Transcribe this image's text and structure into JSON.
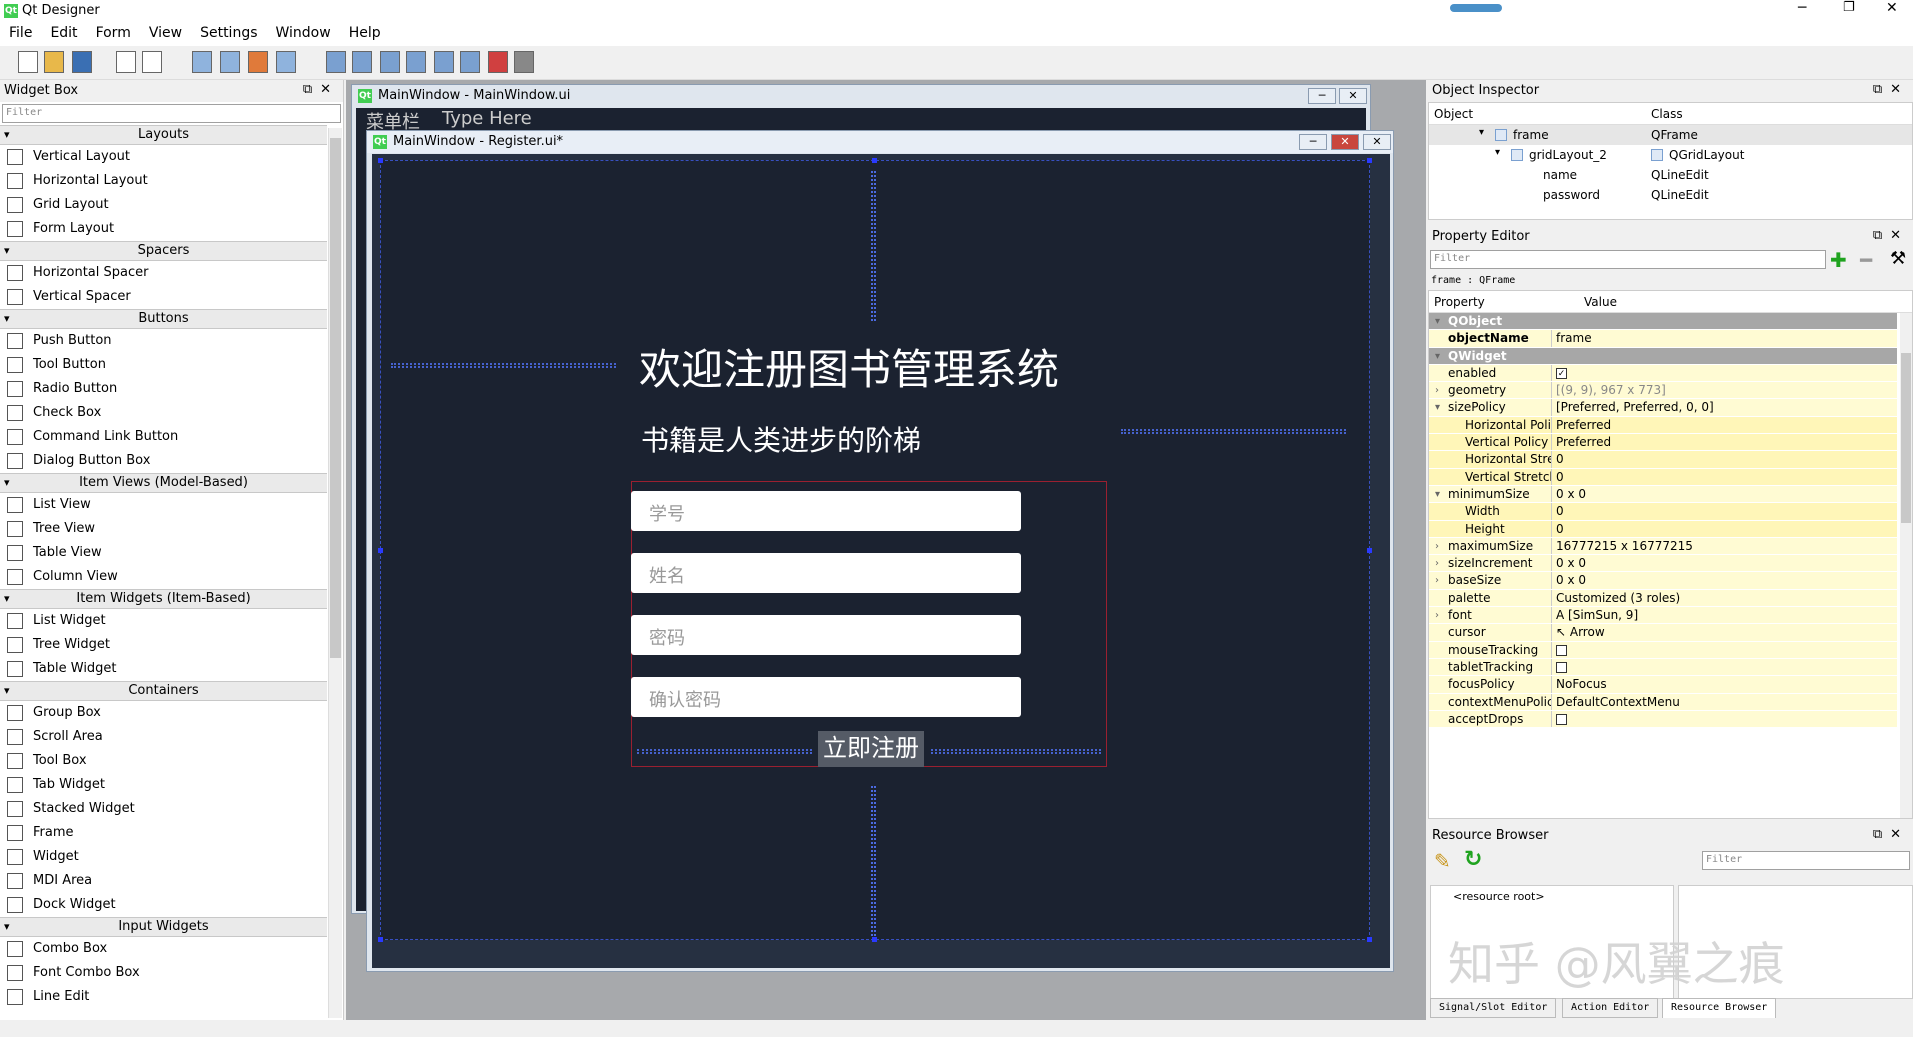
{
  "app": {
    "title": "Qt Designer"
  },
  "menu": [
    "File",
    "Edit",
    "Form",
    "View",
    "Settings",
    "Window",
    "Help"
  ],
  "toolbar_icons": [
    "new-file-icon",
    "open-file-icon",
    "save-icon",
    "send-to-back-icon",
    "bring-to-front-icon",
    "edit-widgets-icon",
    "edit-signals-slots-icon",
    "edit-buddies-icon",
    "edit-tab-order-icon",
    "lay-out-horizontally-icon",
    "lay-out-vertically-icon",
    "lay-out-horizontal-splitter-icon",
    "lay-out-vertical-splitter-icon",
    "lay-out-grid-icon",
    "lay-out-form-icon",
    "break-layout-icon",
    "adjust-size-icon"
  ],
  "widget_box": {
    "title": "Widget Box",
    "filter_placeholder": "Filter",
    "categories": [
      {
        "name": "Layouts",
        "items": [
          "Vertical Layout",
          "Horizontal Layout",
          "Grid Layout",
          "Form Layout"
        ]
      },
      {
        "name": "Spacers",
        "items": [
          "Horizontal Spacer",
          "Vertical Spacer"
        ]
      },
      {
        "name": "Buttons",
        "items": [
          "Push Button",
          "Tool Button",
          "Radio Button",
          "Check Box",
          "Command Link Button",
          "Dialog Button Box"
        ]
      },
      {
        "name": "Item Views (Model-Based)",
        "items": [
          "List View",
          "Tree View",
          "Table View",
          "Column View"
        ]
      },
      {
        "name": "Item Widgets (Item-Based)",
        "items": [
          "List Widget",
          "Tree Widget",
          "Table Widget"
        ]
      },
      {
        "name": "Containers",
        "items": [
          "Group Box",
          "Scroll Area",
          "Tool Box",
          "Tab Widget",
          "Stacked Widget",
          "Frame",
          "Widget",
          "MDI Area",
          "Dock Widget"
        ]
      },
      {
        "name": "Input Widgets",
        "items": [
          "Combo Box",
          "Font Combo Box",
          "Line Edit"
        ]
      }
    ]
  },
  "mdi": {
    "back_window_title": "MainWindow - MainWindow.ui",
    "back_menu_item": "菜单栏",
    "back_type_here": "Type Here",
    "front_window_title": "MainWindow - Register.ui*"
  },
  "form": {
    "heading": "欢迎注册图书管理系统",
    "subheading": "书籍是人类进步的阶梯",
    "fields": [
      "学号",
      "姓名",
      "密码",
      "确认密码"
    ],
    "submit": "立即注册"
  },
  "object_inspector": {
    "title": "Object Inspector",
    "col_object": "Object",
    "col_class": "Class",
    "rows": [
      {
        "object": "frame",
        "class": "QFrame"
      },
      {
        "object": "gridLayout_2",
        "class": "QGridLayout"
      },
      {
        "object": "name",
        "class": "QLineEdit"
      },
      {
        "object": "password",
        "class": "QLineEdit"
      }
    ]
  },
  "property_editor": {
    "title": "Property Editor",
    "filter_placeholder": "Filter",
    "context": "frame : QFrame",
    "col_property": "Property",
    "col_value": "Value",
    "rows": [
      {
        "name": "QObject",
        "value": "",
        "kind": "group"
      },
      {
        "name": "objectName",
        "value": "frame",
        "kind": "bold"
      },
      {
        "name": "QWidget",
        "value": "",
        "kind": "group"
      },
      {
        "name": "enabled",
        "value": "✓",
        "kind": "check"
      },
      {
        "name": "geometry",
        "value": "[(9, 9), 967 x 773]",
        "kind": "dim"
      },
      {
        "name": "sizePolicy",
        "value": "[Preferred, Preferred, 0, 0]",
        "kind": "open"
      },
      {
        "name": "Horizontal Policy",
        "value": "Preferred",
        "kind": "sub"
      },
      {
        "name": "Vertical Policy",
        "value": "Preferred",
        "kind": "sub"
      },
      {
        "name": "Horizontal Stretch",
        "value": "0",
        "kind": "sub"
      },
      {
        "name": "Vertical Stretch",
        "value": "0",
        "kind": "sub"
      },
      {
        "name": "minimumSize",
        "value": "0 x 0",
        "kind": "open"
      },
      {
        "name": "Width",
        "value": "0",
        "kind": "sub"
      },
      {
        "name": "Height",
        "value": "0",
        "kind": "sub"
      },
      {
        "name": "maximumSize",
        "value": "16777215 x 16777215",
        "kind": "closed"
      },
      {
        "name": "sizeIncrement",
        "value": "0 x 0",
        "kind": "closed"
      },
      {
        "name": "baseSize",
        "value": "0 x 0",
        "kind": "closed"
      },
      {
        "name": "palette",
        "value": "Customized (3 roles)",
        "kind": "plain"
      },
      {
        "name": "font",
        "value": "A  [SimSun, 9]",
        "kind": "closed"
      },
      {
        "name": "cursor",
        "value": "↖  Arrow",
        "kind": "plain"
      },
      {
        "name": "mouseTracking",
        "value": "",
        "kind": "check"
      },
      {
        "name": "tabletTracking",
        "value": "",
        "kind": "check"
      },
      {
        "name": "focusPolicy",
        "value": "NoFocus",
        "kind": "plain"
      },
      {
        "name": "contextMenuPolicy",
        "value": "DefaultContextMenu",
        "kind": "plain"
      },
      {
        "name": "acceptDrops",
        "value": "",
        "kind": "check"
      }
    ]
  },
  "resource_browser": {
    "title": "Resource Browser",
    "filter_placeholder": "Filter",
    "root": "<resource root>"
  },
  "bottom_tabs": [
    "Signal/Slot Editor",
    "Action Editor",
    "Resource Browser"
  ],
  "watermark": "知乎 @风翼之痕"
}
